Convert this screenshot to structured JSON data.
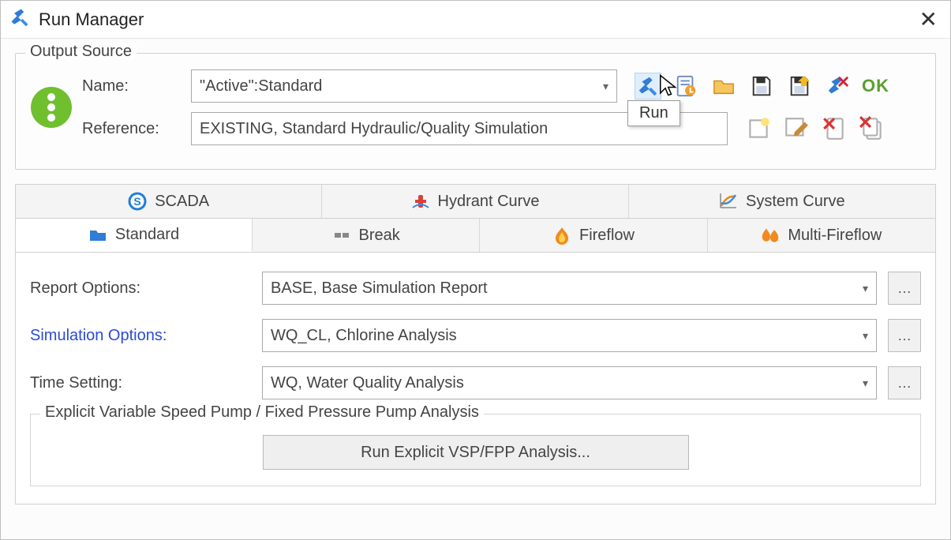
{
  "window": {
    "title": "Run Manager"
  },
  "output_source": {
    "legend": "Output Source",
    "name_label": "Name:",
    "name_value": "\"Active\":Standard",
    "reference_label": "Reference:",
    "reference_value": "EXISTING, Standard Hydraulic/Quality Simulation",
    "tooltip": "Run",
    "ok_label": "OK"
  },
  "tabs_row1": [
    {
      "label": "SCADA"
    },
    {
      "label": "Hydrant Curve"
    },
    {
      "label": "System Curve"
    }
  ],
  "tabs_row2": [
    {
      "label": "Standard",
      "active": true
    },
    {
      "label": "Break"
    },
    {
      "label": "Fireflow"
    },
    {
      "label": "Multi-Fireflow"
    }
  ],
  "form": {
    "report_label": "Report Options:",
    "report_value": "BASE, Base Simulation Report",
    "simulation_label": "Simulation Options:",
    "simulation_value": "WQ_CL, Chlorine Analysis",
    "time_label": "Time Setting:",
    "time_value": "WQ, Water Quality Analysis"
  },
  "vsp": {
    "legend": "Explicit Variable Speed Pump / Fixed Pressure Pump Analysis",
    "button": "Run Explicit VSP/FPP Analysis..."
  }
}
